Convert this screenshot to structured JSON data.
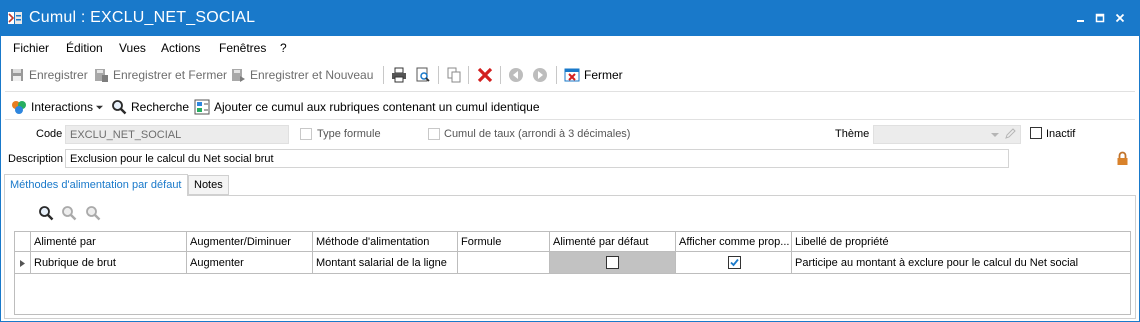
{
  "window": {
    "title": "Cumul : EXCLU_NET_SOCIAL",
    "colors": {
      "titlebar": "#1979ca",
      "active_tab": "#1979ca",
      "grid_selected_cell": "#c2c2c2"
    }
  },
  "menu": {
    "items": [
      "Fichier",
      "Édition",
      "Vues",
      "Actions",
      "Fenêtres",
      "?"
    ]
  },
  "toolbar": {
    "save": "Enregistrer",
    "save_close": "Enregistrer et Fermer",
    "save_new": "Enregistrer et Nouveau",
    "close": "Fermer",
    "icons": [
      "save-icon",
      "save-close-icon",
      "save-new-icon",
      "print-icon",
      "print-preview-icon",
      "copy-icon",
      "delete-icon",
      "previous-icon",
      "next-icon",
      "close-window-icon"
    ]
  },
  "toolbar2": {
    "interactions": "Interactions",
    "search": "Recherche",
    "add_cumul": "Ajouter ce cumul aux rubriques contenant un cumul identique"
  },
  "form": {
    "code_label": "Code",
    "code_value": "EXCLU_NET_SOCIAL",
    "type_formule_label": "Type formule",
    "type_formule_checked": false,
    "cumul_taux_label": "Cumul de taux (arrondi à 3 décimales)",
    "cumul_taux_checked": false,
    "theme_label": "Thème",
    "theme_value": "",
    "inactif_label": "Inactif",
    "inactif_checked": false,
    "description_label": "Description",
    "description_value": "Exclusion pour le calcul du Net social brut"
  },
  "tabs": [
    {
      "label": "Méthodes d'alimentation par défaut",
      "active": true
    },
    {
      "label": "Notes",
      "active": false
    }
  ],
  "grid": {
    "columns": [
      "Alimenté par",
      "Augmenter/Diminuer",
      "Méthode d'alimentation",
      "Formule",
      "Alimenté par défaut",
      "Afficher comme prop...",
      "Libellé de propriété"
    ],
    "rows": [
      {
        "alimente_par": "Rubrique de brut",
        "augmenter_diminuer": "Augmenter",
        "methode": "Montant salarial de la ligne",
        "formule": "",
        "alimente_par_defaut": false,
        "afficher_comme_prop": true,
        "libelle": "Participe au montant à exclure pour le calcul du Net social"
      }
    ]
  }
}
